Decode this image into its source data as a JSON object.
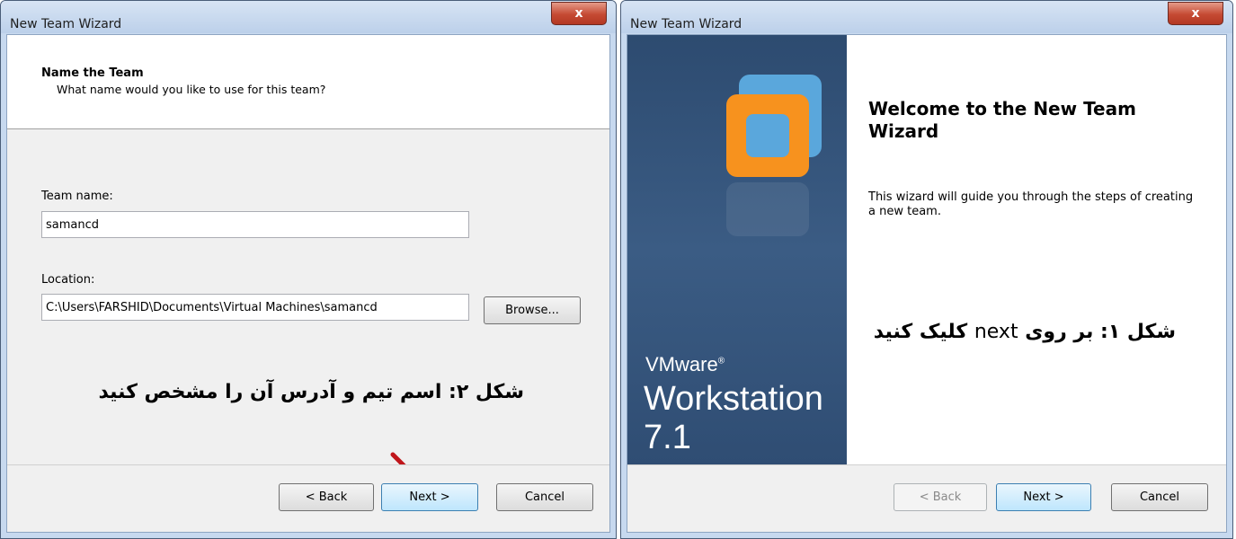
{
  "windows": {
    "name_team": {
      "title": "New Team Wizard",
      "close_glyph": "x",
      "header": {
        "title": "Name the Team",
        "subtitle": "What name would you like to use for this team?"
      },
      "team_name": {
        "label": "Team name:",
        "value": "samancd"
      },
      "location": {
        "label": "Location:",
        "value": "C:\\Users\\FARSHID\\Documents\\Virtual Machines\\samancd",
        "browse_label": "Browse..."
      },
      "caption": "شکل ۲: اسم تیم و آدرس آن را مشخص کنید",
      "buttons": {
        "back": "< Back",
        "next": "Next >",
        "cancel": "Cancel"
      }
    },
    "welcome": {
      "title": "New Team Wizard",
      "close_glyph": "x",
      "brand": {
        "vmware": "VMware",
        "product": "Workstation 7.1"
      },
      "heading": "Welcome to the New Team Wizard",
      "description": "This wizard will guide you through the steps of creating a new team.",
      "caption_part1": "شکل ۱: بر روی",
      "caption_word": "next",
      "caption_part2": "کلیک کنید",
      "buttons": {
        "back": "< Back",
        "next": "Next >",
        "cancel": "Cancel"
      }
    }
  },
  "colors": {
    "sidebar": "#34547c",
    "arrow": "#c0161b",
    "close_button": "#c54a33",
    "logo_orange": "#f7921e",
    "logo_blue": "#5aa7dc"
  }
}
